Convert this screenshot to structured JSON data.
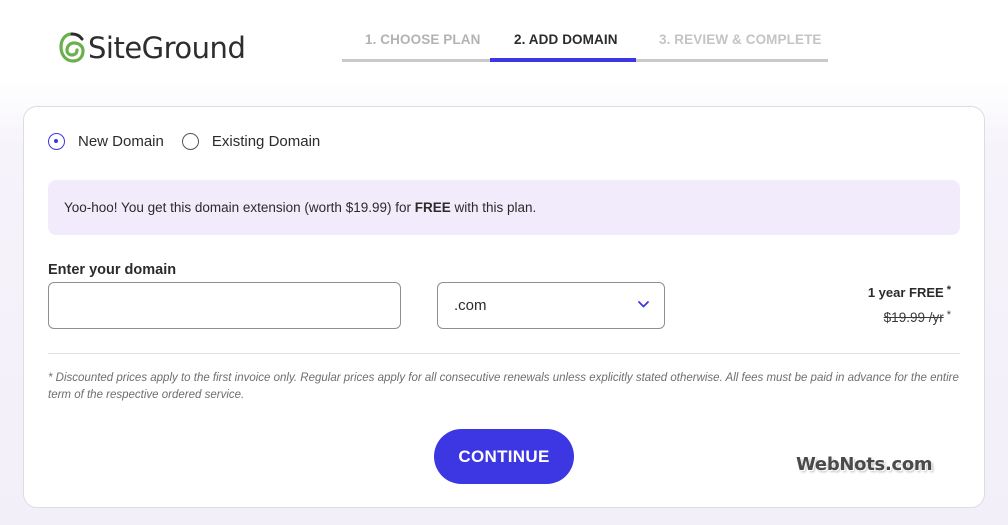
{
  "brand": {
    "name": "SiteGround",
    "logo_icon": "siteground-swirl-icon",
    "accent": "#3d36e3"
  },
  "steps": [
    {
      "label": "1. CHOOSE PLAN",
      "state": "done"
    },
    {
      "label": "2. ADD DOMAIN",
      "state": "active"
    },
    {
      "label": "3. REVIEW & COMPLETE",
      "state": "upcoming"
    }
  ],
  "domain_options": {
    "selected": "new",
    "new_label": "New Domain",
    "existing_label": "Existing Domain"
  },
  "promo": {
    "text_before": "Yoo-hoo! You get this domain extension (worth $19.99) for ",
    "bold": "FREE",
    "text_after": " with this plan.",
    "background": "#f1ebfb"
  },
  "domain_form": {
    "label": "Enter your domain",
    "input_value": "",
    "extension_selected": ".com"
  },
  "pricing": {
    "free_text": "1 year FREE",
    "old_price": "$19.99 /yr",
    "asterisk": "*"
  },
  "disclaimer": "* Discounted prices apply to the first invoice only. Regular prices apply for all consecutive renewals unless explicitly stated otherwise. All fees must be paid in advance for the entire term of the respective ordered service.",
  "continue_label": "CONTINUE",
  "watermark": "WebNots.com"
}
